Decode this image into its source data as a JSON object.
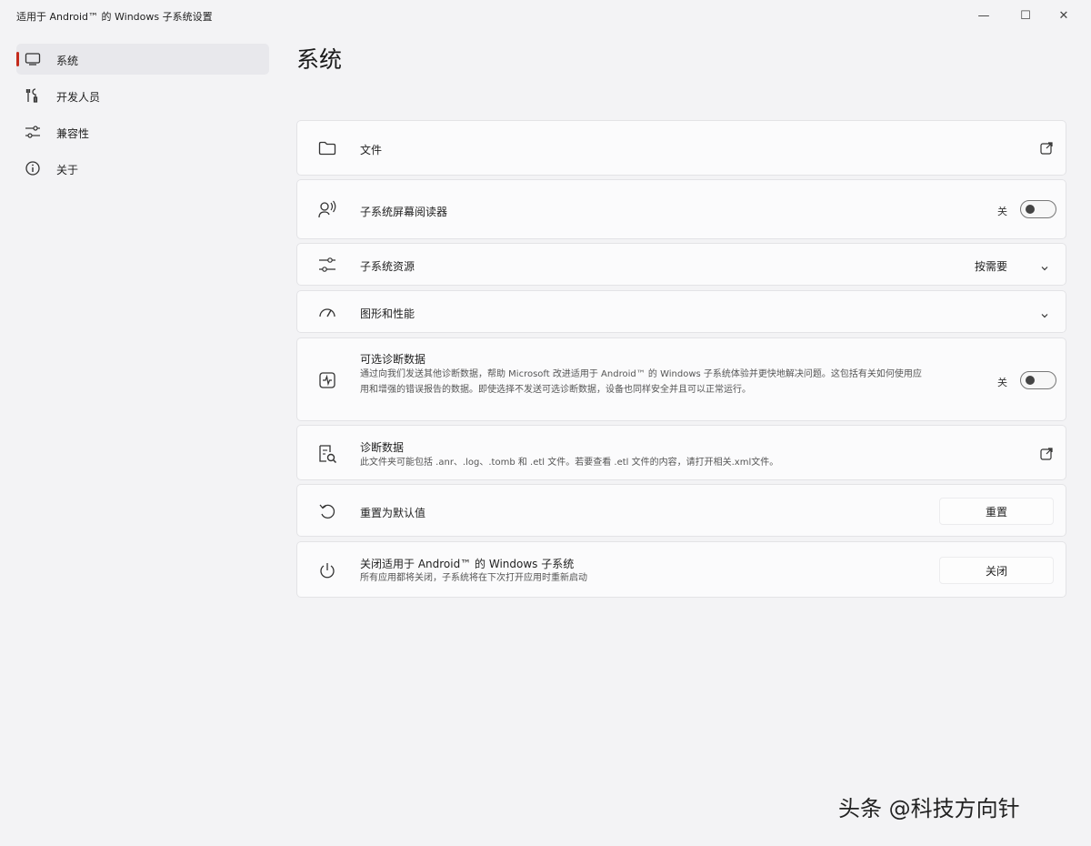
{
  "window": {
    "title": "适用于 Android™ 的 Windows 子系统设置",
    "controls": {
      "minimize": "—",
      "maximize": "☐",
      "close": "✕"
    }
  },
  "sidebar": {
    "items": [
      {
        "label": "系统",
        "icon": "laptop-icon",
        "active": true
      },
      {
        "label": "开发人员",
        "icon": "tools-icon",
        "active": false
      },
      {
        "label": "兼容性",
        "icon": "sliders-icon",
        "active": false
      },
      {
        "label": "关于",
        "icon": "info-icon",
        "active": false
      }
    ]
  },
  "page": {
    "title": "系统"
  },
  "settings": {
    "files": {
      "title": "文件",
      "icon": "folder-icon"
    },
    "screen_reader": {
      "title": "子系统屏幕阅读器",
      "toggle_label": "关",
      "icon": "voice-user-icon"
    },
    "resources": {
      "title": "子系统资源",
      "value": "按需要",
      "icon": "sliders-icon"
    },
    "graphics": {
      "title": "图形和性能",
      "icon": "gauge-icon"
    },
    "optional_diagnostics": {
      "title": "可选诊断数据",
      "description": "通过向我们发送其他诊断数据，帮助 Microsoft 改进适用于 Android™ 的 Windows 子系统体验并更快地解决问题。这包括有关如何使用应用和增强的错误报告的数据。即使选择不发送可选诊断数据，设备也同样安全并且可以正常运行。",
      "toggle_label": "关",
      "icon": "activity-icon"
    },
    "diagnostics": {
      "title": "诊断数据",
      "description": "此文件夹可能包括 .anr、.log、.tomb 和 .etl 文件。若要查看 .etl 文件的内容，请打开相关.xml文件。",
      "icon": "report-search-icon"
    },
    "reset": {
      "title": "重置为默认值",
      "button": "重置",
      "icon": "undo-icon"
    },
    "shutdown": {
      "title": "关闭适用于 Android™ 的 Windows 子系统",
      "description": "所有应用都将关闭，子系统将在下次打开应用时重新启动",
      "button": "关闭",
      "icon": "power-icon"
    }
  },
  "watermark": "头条 @科技方向针",
  "colors": {
    "accent": "#c42b1c",
    "background": "#f3f3f5",
    "card": "#fbfbfc"
  }
}
